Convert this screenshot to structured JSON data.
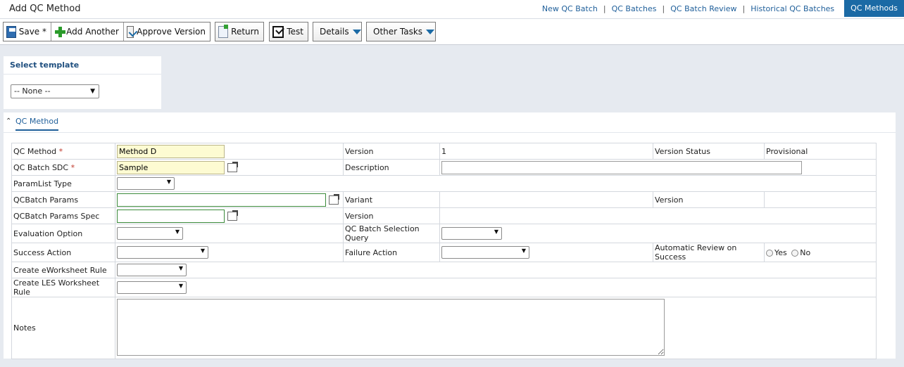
{
  "page": {
    "title": "Add QC Method"
  },
  "top_nav": {
    "links": [
      {
        "label": "New QC Batch"
      },
      {
        "label": "QC Batches"
      },
      {
        "label": "QC Batch Review"
      },
      {
        "label": "Historical QC Batches"
      },
      {
        "label": "QC Methods",
        "active": true
      }
    ],
    "separator": "|"
  },
  "toolbar": {
    "save_label": "Save *",
    "add_another_label": "Add Another",
    "approve_version_label": "Approve Version",
    "return_label": "Return",
    "test_label": "Test",
    "details_label": "Details",
    "other_tasks_label": "Other Tasks"
  },
  "template": {
    "title": "Select template",
    "selected": "-- None --"
  },
  "section": {
    "label": "QC Method"
  },
  "form": {
    "qc_method": {
      "label": "QC Method",
      "required_mark": "*",
      "value": "Method D"
    },
    "version": {
      "label": "Version",
      "value": "1"
    },
    "version_status": {
      "label": "Version Status",
      "value": "Provisional"
    },
    "qc_batch_sdc": {
      "label": "QC Batch SDC",
      "required_mark": "*",
      "value": "Sample"
    },
    "description": {
      "label": "Description",
      "value": ""
    },
    "paramlist_type": {
      "label": "ParamList Type",
      "value": ""
    },
    "qcbatch_params": {
      "label": "QCBatch Params",
      "value": ""
    },
    "variant": {
      "label": "Variant",
      "value": ""
    },
    "params_version": {
      "label": "Version",
      "value": ""
    },
    "qcbatch_params_spec": {
      "label": "QCBatch Params Spec",
      "value": ""
    },
    "spec_version": {
      "label": "Version",
      "value": ""
    },
    "evaluation_option": {
      "label": "Evaluation Option",
      "value": ""
    },
    "qc_batch_selection_query": {
      "label": "QC Batch Selection Query",
      "value": ""
    },
    "success_action": {
      "label": "Success Action",
      "value": ""
    },
    "failure_action": {
      "label": "Failure Action",
      "value": ""
    },
    "automatic_review": {
      "label": "Automatic Review on Success",
      "yes_label": "Yes",
      "no_label": "No"
    },
    "create_eworksheet_rule": {
      "label": "Create eWorksheet Rule",
      "value": ""
    },
    "create_les_worksheet_rule": {
      "label": "Create LES Worksheet Rule",
      "value": ""
    },
    "notes": {
      "label": "Notes",
      "value": ""
    }
  }
}
